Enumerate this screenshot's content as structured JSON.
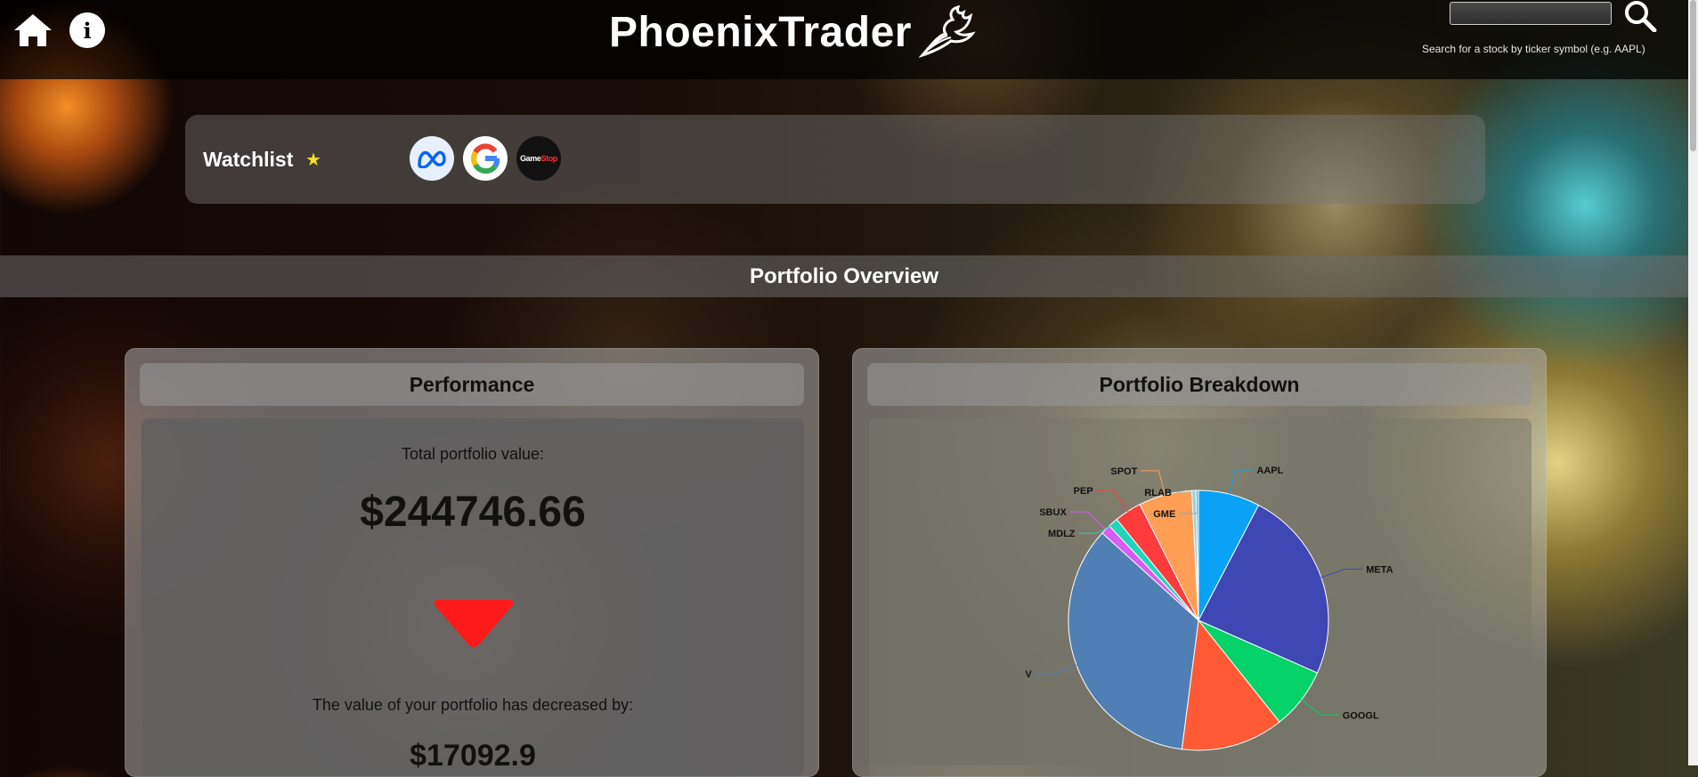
{
  "app": {
    "title": "PhoenixTrader"
  },
  "search": {
    "placeholder": "",
    "hint": "Search for a stock by ticker symbol (e.g. AAPL)"
  },
  "watchlist": {
    "title": "Watchlist",
    "items": [
      {
        "icon": "meta-logo-icon"
      },
      {
        "icon": "google-logo-icon"
      },
      {
        "icon": "gamestop-logo-icon",
        "label_a": "Game",
        "label_b": "Stop"
      }
    ]
  },
  "overview": {
    "title": "Portfolio Overview"
  },
  "performance": {
    "title": "Performance",
    "total_label": "Total portfolio value:",
    "total_value": "$244746.66",
    "trend": "down",
    "change_label": "The value of your portfolio has decreased by:",
    "change_value": "$17092.9"
  },
  "breakdown": {
    "title": "Portfolio Breakdown"
  },
  "colors": {
    "down_arrow": "#ff1a1a",
    "star": "#f4e21b"
  },
  "chart_data": {
    "type": "pie",
    "categories": [
      "AAPL",
      "META",
      "GOOGL",
      "",
      "V",
      "SBUX",
      "MDLZ",
      "PEP",
      "SPOT",
      "RLAB",
      "GME"
    ],
    "values": [
      7.5,
      23.5,
      7.5,
      12.5,
      34.0,
      1.2,
      1.2,
      3.3,
      6.5,
      0.5,
      0.3
    ],
    "colors": [
      "#0aa2f6",
      "#3f47b4",
      "#05d36a",
      "#ff5a36",
      "#4f7fb4",
      "#d65cf2",
      "#1fd6b8",
      "#ff3b3b",
      "#ff9f55",
      "#9fd0d6",
      "#5fb8e8"
    ]
  }
}
